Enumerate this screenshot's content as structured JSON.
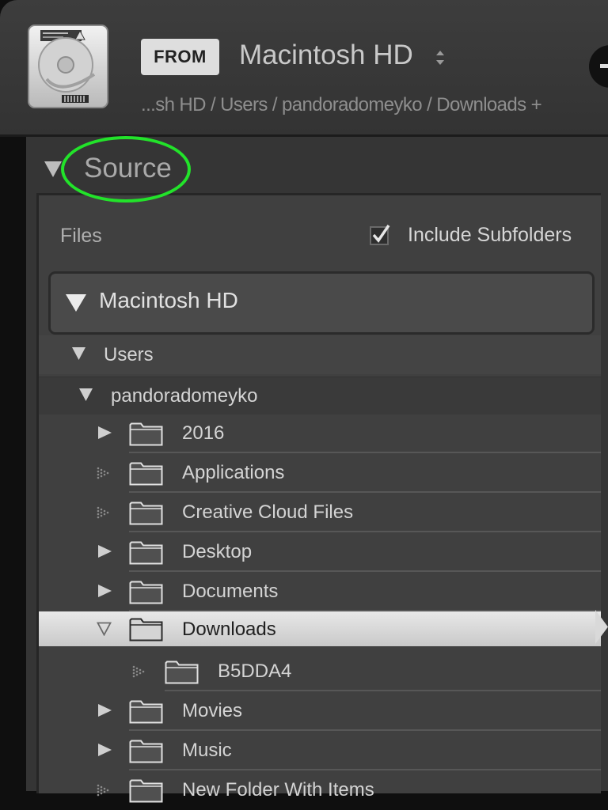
{
  "header": {
    "from_label": "FROM",
    "volume_name": "Macintosh HD",
    "path": "...sh HD / Users / pandoradomeyko / Downloads +"
  },
  "source_panel": {
    "title": "Source",
    "files_label": "Files",
    "include_subfolders_label": "Include Subfolders",
    "include_subfolders_checked": true,
    "volume": "Macintosh HD",
    "users_folder": "Users",
    "user_folder": "pandoradomeyko",
    "folders": [
      {
        "name": "2016",
        "expander": "collapsed"
      },
      {
        "name": "Applications",
        "expander": "none"
      },
      {
        "name": "Creative Cloud Files",
        "expander": "none"
      },
      {
        "name": "Desktop",
        "expander": "collapsed"
      },
      {
        "name": "Documents",
        "expander": "collapsed"
      },
      {
        "name": "Downloads",
        "expander": "expanded",
        "selected": true
      },
      {
        "name": "B5DDA4",
        "expander": "none",
        "child_of": "Downloads"
      },
      {
        "name": "Movies",
        "expander": "collapsed"
      },
      {
        "name": "Music",
        "expander": "collapsed"
      },
      {
        "name": "New Folder With Items",
        "expander": "none"
      }
    ]
  },
  "colors": {
    "annotation_ring": "#22e32a",
    "selection_bg": "#d9d9d9",
    "panel_bg": "#404040"
  }
}
